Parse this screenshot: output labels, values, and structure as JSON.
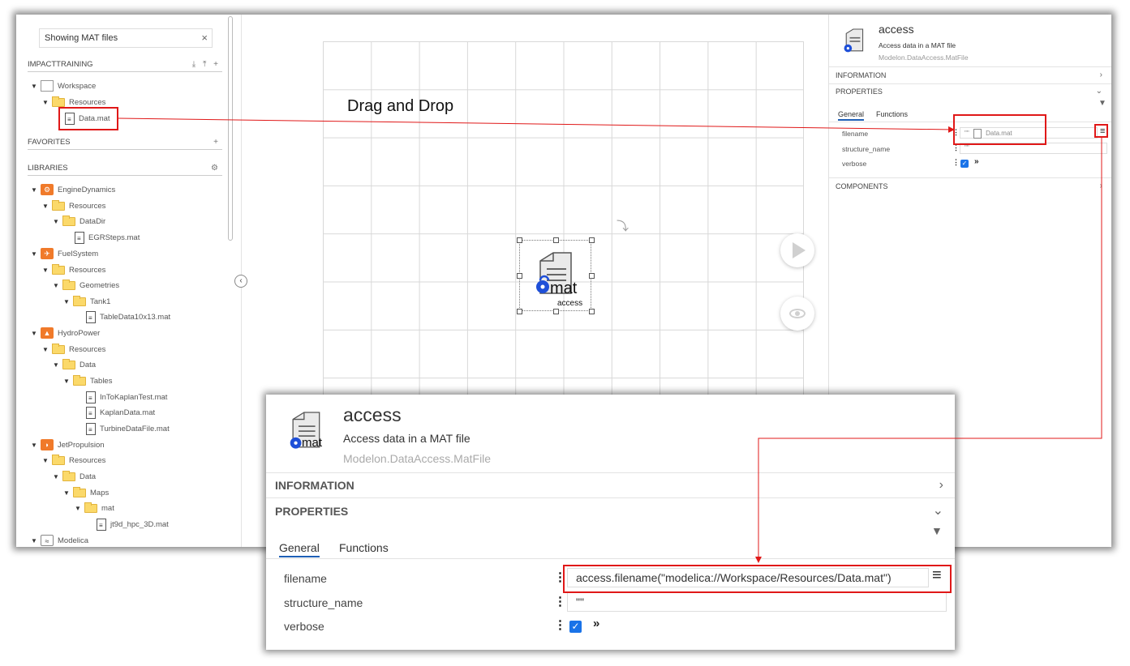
{
  "search": {
    "value": "Showing MAT files",
    "clear": "×"
  },
  "sections": {
    "impact": {
      "label": "IMPACTTRAINING",
      "actions": "⤓ ⤒ +"
    },
    "favorites": {
      "label": "FAVORITES",
      "action": "+"
    },
    "libraries": {
      "label": "LIBRARIES",
      "action": "⚙"
    }
  },
  "tree": {
    "workspace": "Workspace",
    "ws_resources": "Resources",
    "ws_datamat": "Data.mat",
    "engine": "EngineDynamics",
    "engine_resources": "Resources",
    "engine_datadir": "DataDir",
    "engine_egr": "EGRSteps.mat",
    "fuel": "FuelSystem",
    "fuel_resources": "Resources",
    "fuel_geometries": "Geometries",
    "fuel_tank1": "Tank1",
    "fuel_table": "TableData10x13.mat",
    "hydro": "HydroPower",
    "hydro_resources": "Resources",
    "hydro_data": "Data",
    "hydro_tables": "Tables",
    "hydro_f1": "InToKaplanTest.mat",
    "hydro_f2": "KaplanData.mat",
    "hydro_f3": "TurbineDataFile.mat",
    "jet": "JetPropulsion",
    "jet_resources": "Resources",
    "jet_data": "Data",
    "jet_maps": "Maps",
    "jet_mat": "mat",
    "jet_file": "jt9d_hpc_3D.mat",
    "modelica": "Modelica"
  },
  "canvas": {
    "annotation": "Drag and Drop",
    "component_label": "access",
    "component_badge": "mat"
  },
  "panel": {
    "title": "access",
    "description": "Access data in a MAT file",
    "path": "Modelon.DataAccess.MatFile",
    "information": "INFORMATION",
    "properties": "PROPERTIES",
    "components": "COMPONENTS",
    "tab_general": "General",
    "tab_functions": "Functions",
    "filename_label": "filename",
    "filename_value": "Data.mat",
    "filename_quote": "\"\"",
    "structure_label": "structure_name",
    "structure_value": "\"\"",
    "verbose_label": "verbose"
  },
  "zoom": {
    "title": "access",
    "description": "Access data in a MAT file",
    "path": "Modelon.DataAccess.MatFile",
    "information": "INFORMATION",
    "properties": "PROPERTIES",
    "tab_general": "General",
    "tab_functions": "Functions",
    "filename_label": "filename",
    "filename_value": "access.filename(\"modelica://Workspace/Resources/Data.mat\")",
    "structure_label": "structure_name",
    "structure_value": "\"\"",
    "verbose_label": "verbose"
  },
  "colors": {
    "highlight": "#e01818",
    "accent": "#1a73e8",
    "library_icon": "#f07a2a",
    "folder": "#fbd96a"
  }
}
